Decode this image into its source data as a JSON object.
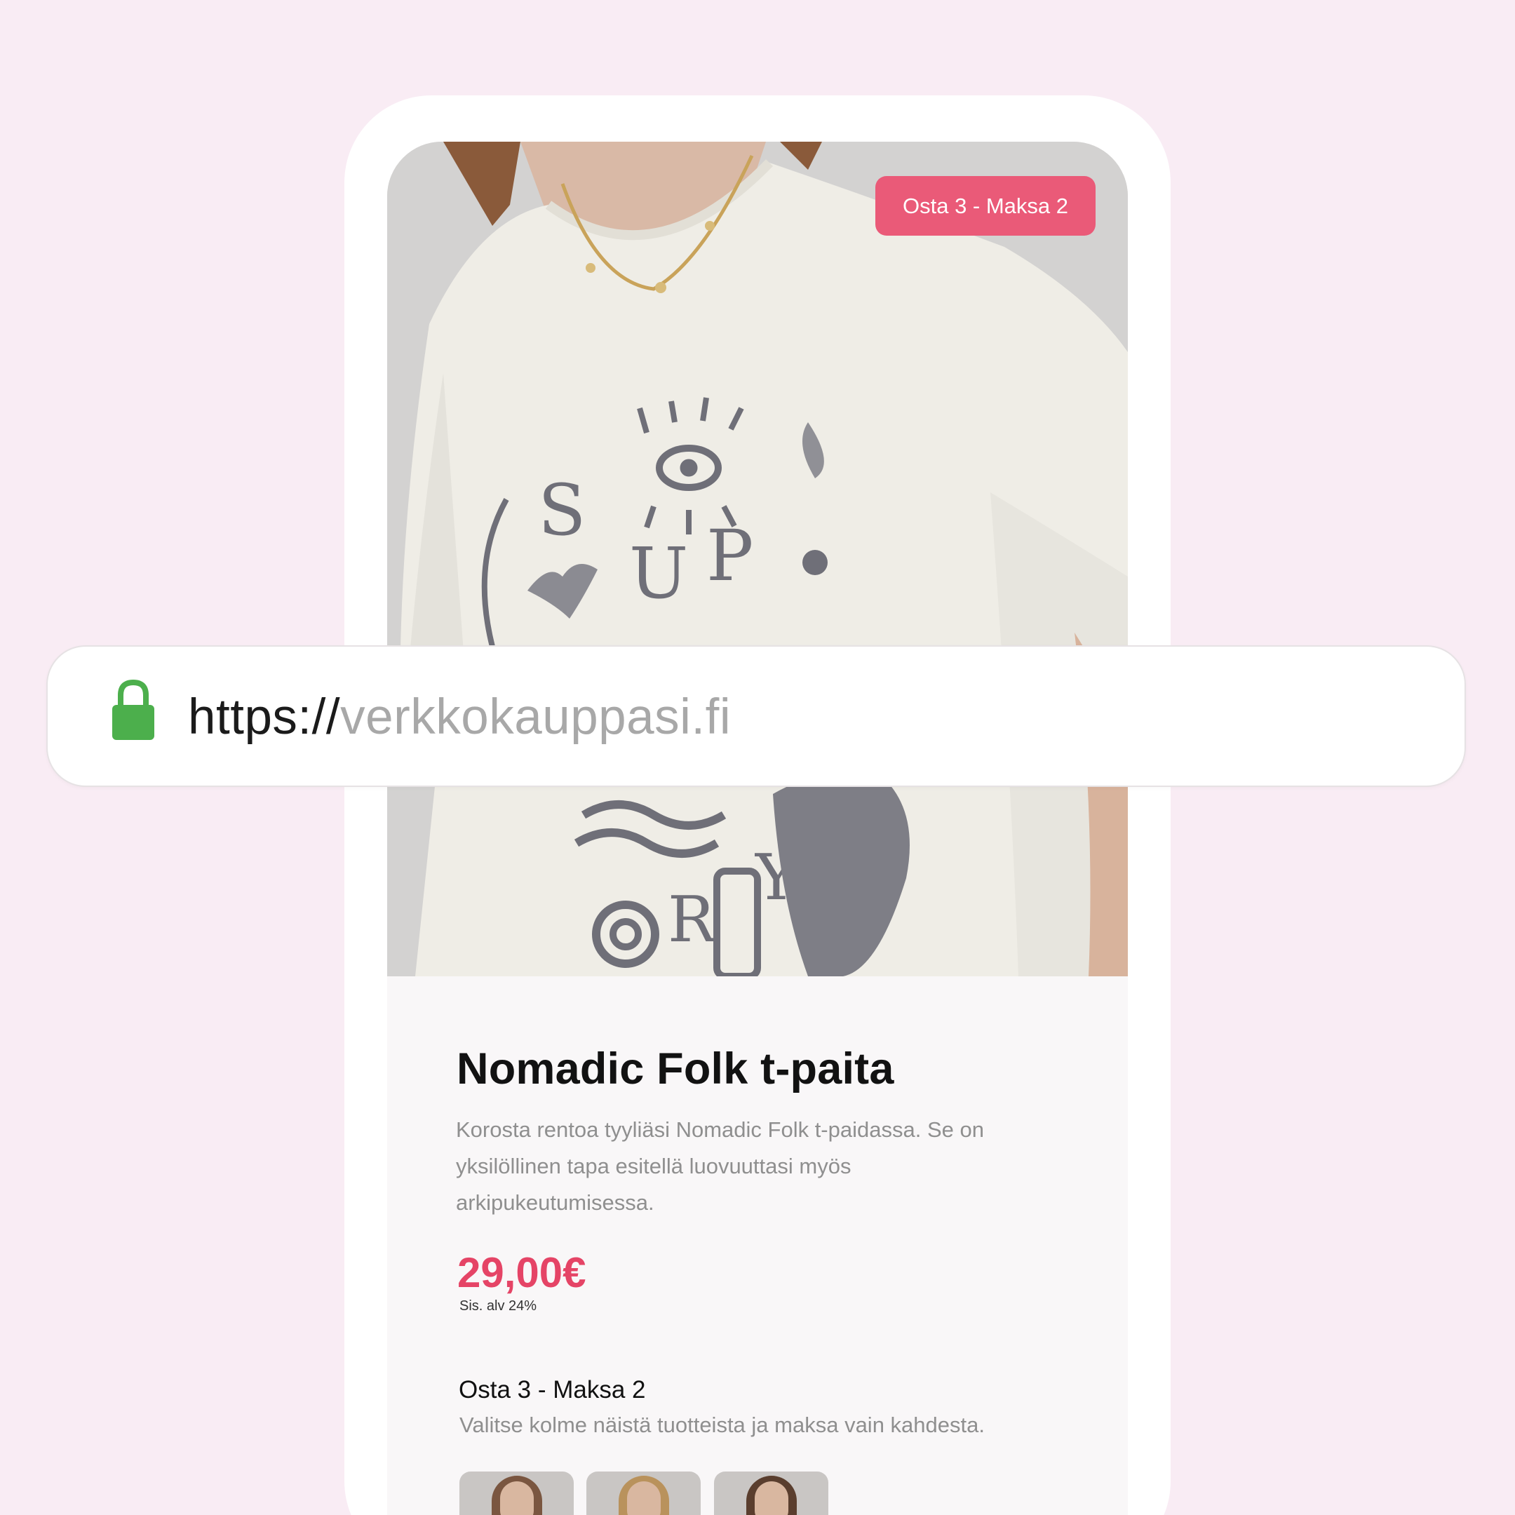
{
  "colors": {
    "background": "#f9ecf4",
    "badge": "#ea5a78",
    "price": "#e54466",
    "lock": "#4caf4c"
  },
  "urlbar": {
    "scheme": "https://",
    "host": "verkkokauppasi.fi",
    "lock_icon": "lock-icon"
  },
  "product": {
    "badge_label": "Osta 3 - Maksa 2",
    "title": "Nomadic Folk t-paita",
    "description": "Korosta rentoa tyyliäsi Nomadic Folk t-paidassa. Se on yksilöllinen tapa esitellä luovuuttasi myös arkipukeutumisessa.",
    "price": "29,00€",
    "vat_note": "Sis. alv 24%"
  },
  "bundle": {
    "title": "Osta 3 - Maksa 2",
    "subtitle": "Valitse kolme näistä tuotteista ja maksa vain kahdesta.",
    "thumbnails": [
      "product-thumbnail-1",
      "product-thumbnail-2",
      "product-thumbnail-3"
    ]
  }
}
